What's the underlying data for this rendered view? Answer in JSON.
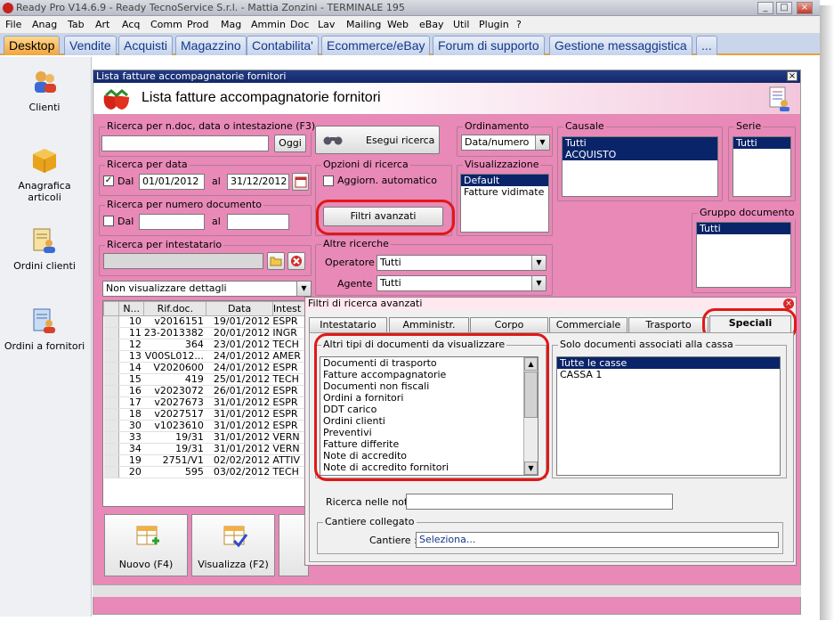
{
  "window": {
    "title": "Ready Pro V14.6.9 - Ready TecnoService S.r.l. - Mattia Zonzini - TERMINALE 195"
  },
  "menu": [
    "File",
    "Anag",
    "Tab",
    "Art",
    "Acq",
    "Comm",
    "Prod",
    "Mag",
    "Ammin",
    "Doc",
    "Lav",
    "Mailing",
    "Web",
    "eBay",
    "Util",
    "Plugin",
    "?"
  ],
  "tabs": [
    "Desktop",
    "Vendite",
    "Acquisti",
    "Magazzino",
    "Contabilita'",
    "Ecommerce/eBay",
    "Forum di supporto",
    "Gestione messaggistica",
    "..."
  ],
  "sidebar": [
    {
      "label": "Clienti",
      "icon": "clienti-icon"
    },
    {
      "label": "Anagrafica articoli",
      "icon": "articoli-icon"
    },
    {
      "label": "Ordini clienti",
      "icon": "ordini-clienti-icon"
    },
    {
      "label": "Ordini a fornitori",
      "icon": "ordini-fornitori-icon"
    }
  ],
  "child": {
    "title": "Lista fatture accompagnatorie fornitori",
    "page_title": "Lista fatture accompagnatorie fornitori"
  },
  "search": {
    "ndoc_label": "Ricerca per n.doc, data o intestazione (F3)",
    "ndoc_value": "",
    "oggi": "Oggi",
    "date_label": "Ricerca per data",
    "dal": "Dal",
    "al": "al",
    "date_from": "01/01/2012",
    "date_to": "31/12/2012",
    "num_label": "Ricerca per numero documento",
    "num_from": "",
    "num_to": "",
    "owner_label": "Ricerca per intestatario",
    "owner_value": "",
    "details_value": "Non visualizzare dettagli",
    "run": "Esegui ricerca"
  },
  "options": {
    "label": "Opzioni di ricerca",
    "auto_update": "Aggiorn. automatico",
    "advanced": "Filtri avanzati"
  },
  "other": {
    "label": "Altre ricerche",
    "operator_label": "Operatore :",
    "operator_value": "Tutti",
    "agent_label": "Agente :",
    "agent_value": "Tutti"
  },
  "ordering": {
    "label": "Ordinamento",
    "value": "Data/numero"
  },
  "visual": {
    "label": "Visualizzazione",
    "items": [
      "Default",
      "Fatture vidimate"
    ]
  },
  "causale": {
    "label": "Causale",
    "items": [
      "Tutti",
      "ACQUISTO"
    ]
  },
  "serie": {
    "label": "Serie",
    "items": [
      "Tutti"
    ]
  },
  "gruppo": {
    "label": "Gruppo documento",
    "items": [
      "Tutti"
    ]
  },
  "grid": {
    "headers": [
      "N...",
      "Rif.doc.",
      "Data",
      "Intest"
    ],
    "rows": [
      [
        "10",
        "v2016151",
        "19/01/2012",
        "ESPR"
      ],
      [
        "11",
        "23-2013382",
        "20/01/2012",
        "INGR"
      ],
      [
        "12",
        "364",
        "23/01/2012",
        "TECH"
      ],
      [
        "13",
        "V00SL012...",
        "24/01/2012",
        "AMER"
      ],
      [
        "14",
        "V2020600",
        "24/01/2012",
        "ESPR"
      ],
      [
        "15",
        "419",
        "25/01/2012",
        "TECH"
      ],
      [
        "16",
        "v2023072",
        "26/01/2012",
        "ESPR"
      ],
      [
        "17",
        "v2027673",
        "31/01/2012",
        "ESPR"
      ],
      [
        "18",
        "v2027517",
        "31/01/2012",
        "ESPR"
      ],
      [
        "30",
        "v1023610",
        "31/01/2012",
        "ESPR"
      ],
      [
        "33",
        "19/31",
        "31/01/2012",
        "VERN"
      ],
      [
        "34",
        "19/31",
        "31/01/2012",
        "VERN"
      ],
      [
        "19",
        "2751/V1",
        "02/02/2012",
        "ATTIV"
      ],
      [
        "20",
        "595",
        "03/02/2012",
        "TECH"
      ]
    ]
  },
  "actions": {
    "new": "Nuovo (F4)",
    "view": "Visualizza (F2)"
  },
  "advanced": {
    "title": "Filtri di ricerca avanzati",
    "tabs": [
      "Intestatario",
      "Amministr.",
      "Corpo",
      "Commerciale",
      "Trasporto",
      "Speciali"
    ],
    "doc_types_label": "Altri tipi di documenti da visualizzare",
    "doc_types": [
      "Documenti di trasporto",
      "Fatture accompagnatorie",
      "Documenti non fiscali",
      "Ordini a fornitori",
      "DDT carico",
      "Ordini clienti",
      "Preventivi",
      "Fatture differite",
      "Note di accredito",
      "Note di accredito fornitori"
    ],
    "cash_label": "Solo documenti associati alla cassa",
    "cash_items": [
      "Tutte le casse",
      "CASSA 1"
    ],
    "notes_label": "Ricerca nelle note",
    "notes_value": "",
    "site_group": "Cantiere collegato",
    "site_label": "Cantiere :",
    "site_value": "Seleziona..."
  },
  "colors": {
    "panel": "#e889b7",
    "tab_active": "#f2a53c",
    "highlight": "#e01818",
    "selection": "#0a246a"
  }
}
